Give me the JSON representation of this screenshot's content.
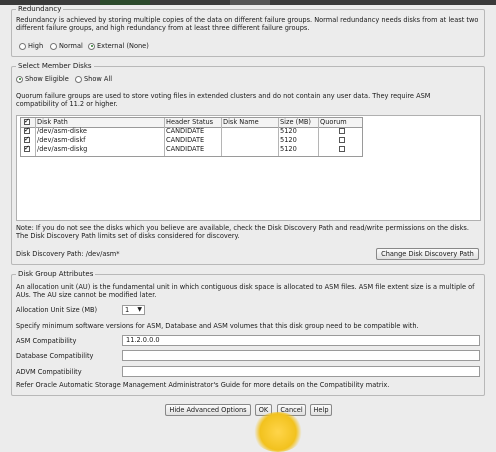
{
  "redundancy": {
    "legend": "Redundancy",
    "description": "Redundancy is achieved by storing multiple copies of the data on different failure groups. Normal redundancy needs disks from at least two different failure groups, and high redundancy from at least three different failure groups.",
    "options": [
      "High",
      "Normal",
      "External (None)"
    ],
    "selected": "External (None)"
  },
  "member_disks": {
    "legend": "Select Member Disks",
    "options": [
      "Show Eligible",
      "Show All"
    ],
    "selected": "Show Eligible",
    "quorum_note": "Quorum failure groups are used to store voting files in extended clusters and do not contain any user data. They require ASM compatibility of 11.2 or higher.",
    "columns": [
      "Disk Path",
      "Header Status",
      "Disk Name",
      "Size (MB)",
      "Quorum"
    ],
    "rows": [
      {
        "checked": true,
        "path": "/dev/asm-diske",
        "status": "CANDIDATE",
        "name": "",
        "size": "5120",
        "quorum": false
      },
      {
        "checked": true,
        "path": "/dev/asm-diskf",
        "status": "CANDIDATE",
        "name": "",
        "size": "5120",
        "quorum": false
      },
      {
        "checked": true,
        "path": "/dev/asm-diskg",
        "status": "CANDIDATE",
        "name": "",
        "size": "5120",
        "quorum": false
      }
    ],
    "note": "Note: If you do not see the disks which you believe are available, check the Disk Discovery Path and read/write permissions on the disks. The Disk Discovery Path limits set of disks considered for discovery.",
    "discovery_path_label": "Disk Discovery Path: /dev/asm*",
    "change_path_button": "Change Disk Discovery Path"
  },
  "attributes": {
    "legend": "Disk Group Attributes",
    "au_note": "An allocation unit (AU) is the fundamental unit in which contiguous disk space is allocated to ASM files. ASM file extent size is a multiple of AUs. The AU size cannot be modified later.",
    "au_label": "Allocation Unit Size (MB)",
    "au_value": "1",
    "compat_note": "Specify minimum software versions for ASM, Database and ASM volumes that this disk group need to be compatible with.",
    "asm_label": "ASM Compatibility",
    "asm_value": "11.2.0.0.0",
    "db_label": "Database Compatibility",
    "db_value": "",
    "advm_label": "ADVM Compatibility",
    "advm_value": "",
    "refer_note": "Refer Oracle Automatic Storage Management Administrator's Guide for more details on the Compatibility matrix."
  },
  "footer": {
    "hide_advanced": "Hide Advanced Options",
    "ok": "OK",
    "cancel": "Cancel",
    "help": "Help"
  }
}
